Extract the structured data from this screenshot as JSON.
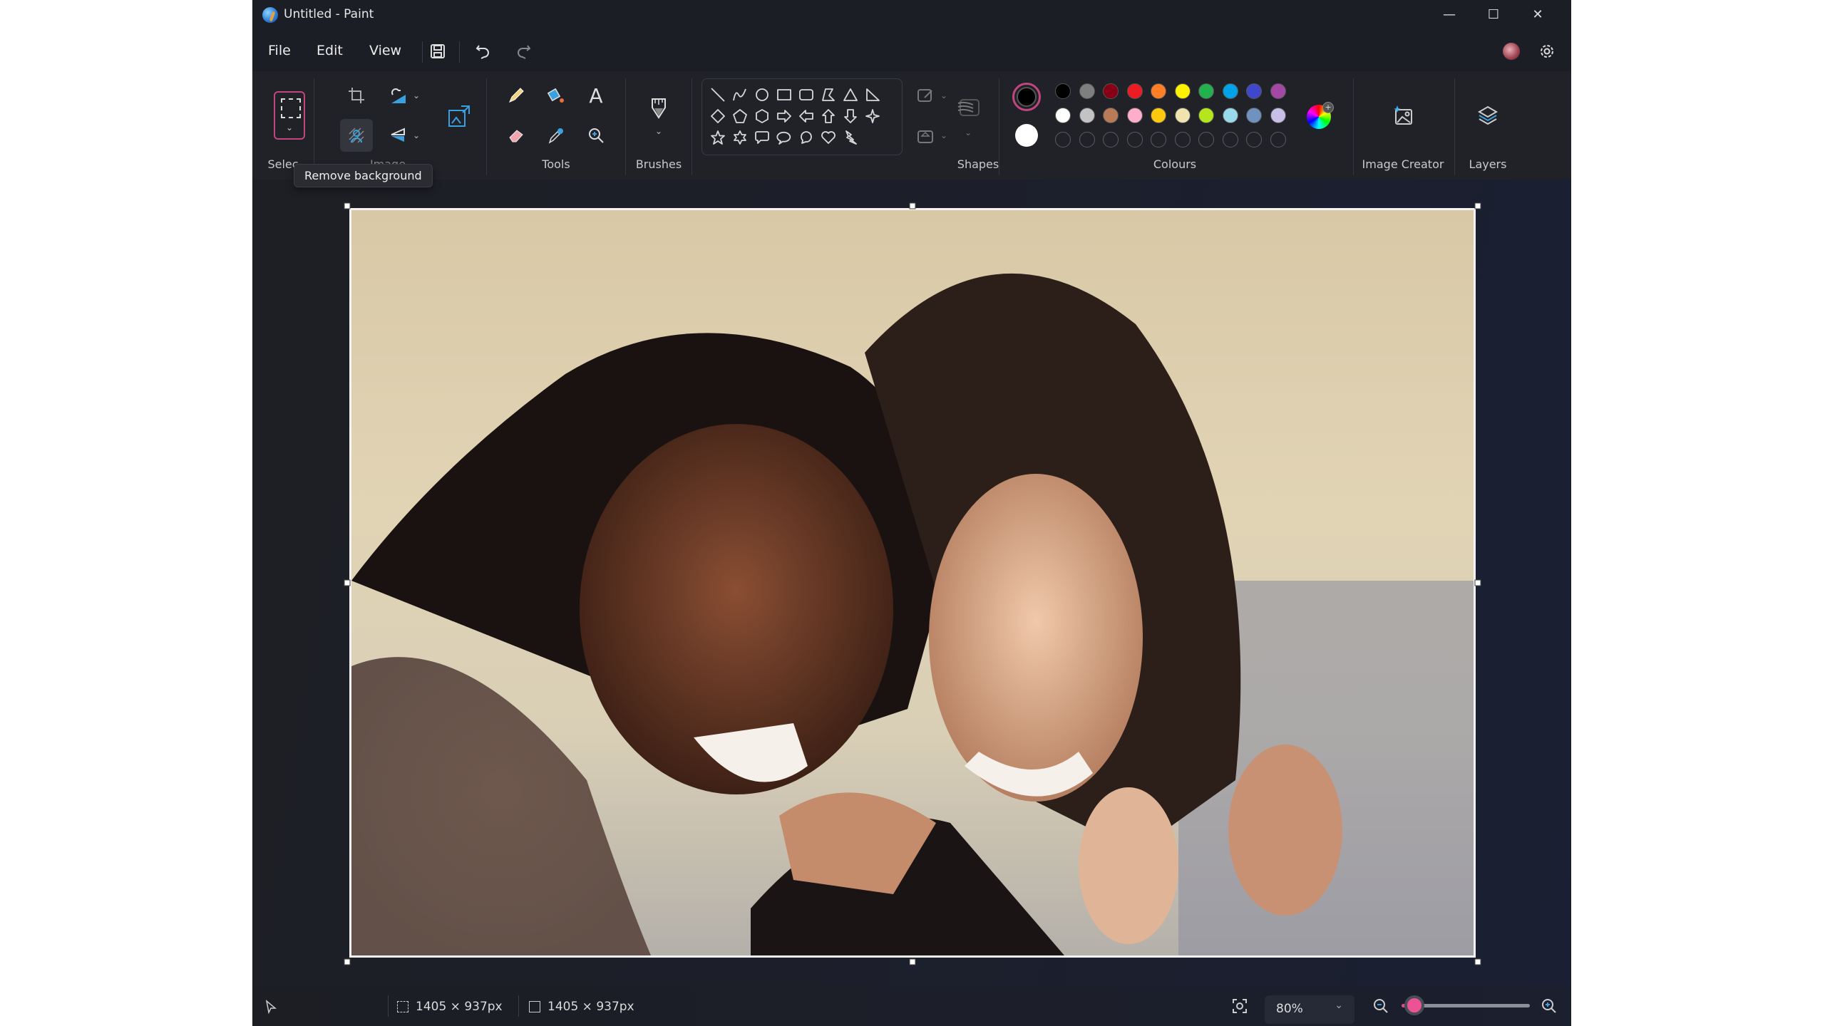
{
  "window": {
    "title": "Untitled - Paint",
    "controls": {
      "minimize": "—",
      "maximize": "☐",
      "close": "✕"
    }
  },
  "menubar": {
    "items": [
      "File",
      "Edit",
      "View"
    ],
    "actions": [
      "save-icon",
      "undo-icon",
      "redo-icon"
    ],
    "right": [
      "account-avatar",
      "settings-icon"
    ]
  },
  "ribbon": {
    "groups": {
      "selection": {
        "label": "Selec"
      },
      "image": {
        "label": "Image",
        "tools": [
          "crop-icon",
          "rotate-icon",
          "remove-background-icon",
          "flip-icon",
          "resize-icon"
        ]
      },
      "tools": {
        "label": "Tools",
        "items": [
          "pencil",
          "fill",
          "text",
          "eraser",
          "color-picker",
          "magnifier"
        ]
      },
      "brushes": {
        "label": "Brushes"
      },
      "shapes": {
        "label": "Shapes",
        "items": [
          "line",
          "curve",
          "oval",
          "rectangle",
          "rounded-rectangle",
          "polygon",
          "triangle",
          "right-triangle",
          "diamond",
          "pentagon",
          "hexagon",
          "right-arrow",
          "left-arrow",
          "up-arrow",
          "down-arrow",
          "four-point-star",
          "five-point-star",
          "six-point-star",
          "rounded-callout",
          "oval-callout",
          "cloud-callout",
          "heart",
          "lightning"
        ]
      },
      "colours": {
        "label": "Colours",
        "primary": "#000000",
        "secondary": "#ffffff",
        "row1": [
          "#000000",
          "#7f7f7f",
          "#880015",
          "#ed1c24",
          "#ff7f27",
          "#fff200",
          "#22b14c",
          "#00a2e8",
          "#3f48cc",
          "#a349a4"
        ],
        "row2": [
          "#ffffff",
          "#c3c3c3",
          "#b97a57",
          "#ffaec9",
          "#ffc90e",
          "#efe4b0",
          "#b5e61d",
          "#99d9ea",
          "#7092be",
          "#c8bfe7"
        ],
        "custom_slots": 10
      },
      "image_creator": {
        "label": "Image Creator"
      },
      "layers": {
        "label": "Layers"
      }
    },
    "tooltip": "Remove background"
  },
  "canvas": {
    "content": "photo of two smiling women"
  },
  "statusbar": {
    "selection_size": "1405 × 937px",
    "canvas_size": "1405 × 937px",
    "zoom_label": "80%",
    "zoom_slider_fraction": 0.1
  }
}
